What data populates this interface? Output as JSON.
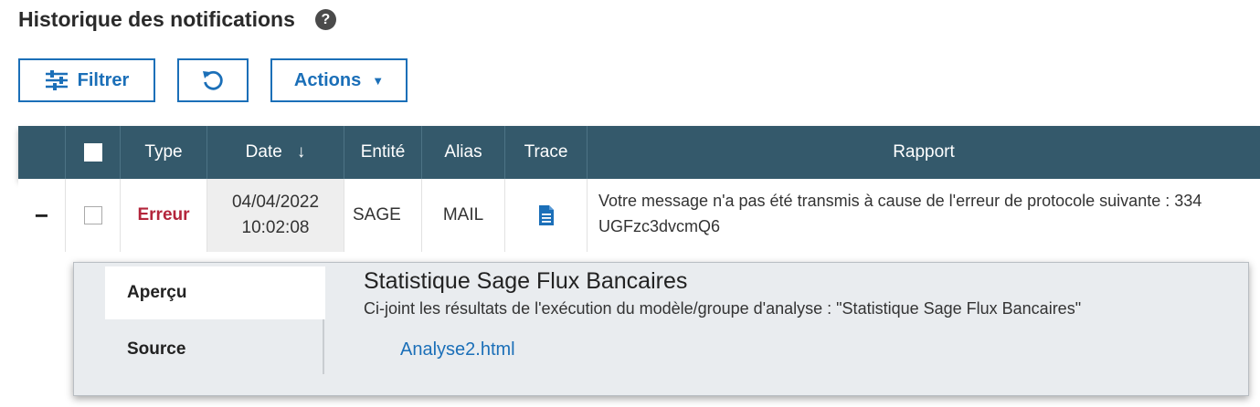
{
  "page": {
    "title": "Historique des notifications",
    "help_icon": "?"
  },
  "toolbar": {
    "filter_label": "Filtrer",
    "filter_icon": "sliders-icon",
    "refresh_icon": "refresh-icon",
    "actions_label": "Actions",
    "actions_caret": "▼"
  },
  "colors": {
    "header_bg": "#34596b",
    "accent": "#1b6fb8",
    "error": "#b3253b"
  },
  "table": {
    "columns": {
      "type": "Type",
      "date": "Date",
      "date_sort": "↓",
      "entity": "Entité",
      "alias": "Alias",
      "trace": "Trace",
      "report": "Rapport"
    },
    "rows": [
      {
        "expand": "−",
        "type": "Erreur",
        "date": "04/04/2022",
        "time": "10:02:08",
        "entity": "SAGE",
        "alias": "MAIL",
        "trace_icon": "document-icon",
        "report_line1": "Votre message n'a pas été transmis à cause de l'erreur de protocole suivante : 334",
        "report_line2": "UGFzc3dvcmQ6"
      }
    ]
  },
  "detail": {
    "tabs": [
      "Aperçu",
      "Source"
    ],
    "active_tab": "Aperçu",
    "title": "Statistique Sage Flux Bancaires",
    "description": "Ci-joint les résultats de l'exécution du modèle/groupe d'analyse : \"Statistique Sage Flux Bancaires\"",
    "attachment": "Analyse2.html"
  }
}
